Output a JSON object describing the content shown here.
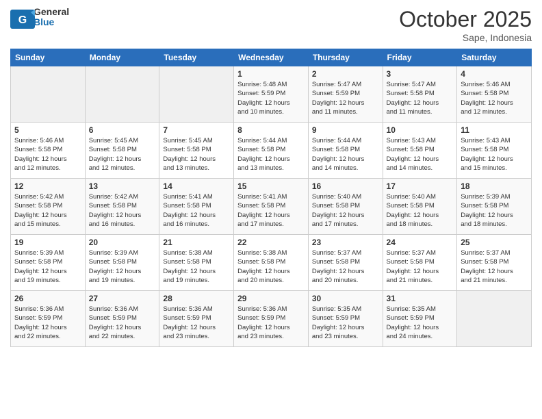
{
  "header": {
    "logo_general": "General",
    "logo_blue": "Blue",
    "title": "October 2025",
    "location": "Sape, Indonesia"
  },
  "days_of_week": [
    "Sunday",
    "Monday",
    "Tuesday",
    "Wednesday",
    "Thursday",
    "Friday",
    "Saturday"
  ],
  "weeks": [
    [
      {
        "day": "",
        "info": ""
      },
      {
        "day": "",
        "info": ""
      },
      {
        "day": "",
        "info": ""
      },
      {
        "day": "1",
        "info": "Sunrise: 5:48 AM\nSunset: 5:59 PM\nDaylight: 12 hours\nand 10 minutes."
      },
      {
        "day": "2",
        "info": "Sunrise: 5:47 AM\nSunset: 5:59 PM\nDaylight: 12 hours\nand 11 minutes."
      },
      {
        "day": "3",
        "info": "Sunrise: 5:47 AM\nSunset: 5:58 PM\nDaylight: 12 hours\nand 11 minutes."
      },
      {
        "day": "4",
        "info": "Sunrise: 5:46 AM\nSunset: 5:58 PM\nDaylight: 12 hours\nand 12 minutes."
      }
    ],
    [
      {
        "day": "5",
        "info": "Sunrise: 5:46 AM\nSunset: 5:58 PM\nDaylight: 12 hours\nand 12 minutes."
      },
      {
        "day": "6",
        "info": "Sunrise: 5:45 AM\nSunset: 5:58 PM\nDaylight: 12 hours\nand 12 minutes."
      },
      {
        "day": "7",
        "info": "Sunrise: 5:45 AM\nSunset: 5:58 PM\nDaylight: 12 hours\nand 13 minutes."
      },
      {
        "day": "8",
        "info": "Sunrise: 5:44 AM\nSunset: 5:58 PM\nDaylight: 12 hours\nand 13 minutes."
      },
      {
        "day": "9",
        "info": "Sunrise: 5:44 AM\nSunset: 5:58 PM\nDaylight: 12 hours\nand 14 minutes."
      },
      {
        "day": "10",
        "info": "Sunrise: 5:43 AM\nSunset: 5:58 PM\nDaylight: 12 hours\nand 14 minutes."
      },
      {
        "day": "11",
        "info": "Sunrise: 5:43 AM\nSunset: 5:58 PM\nDaylight: 12 hours\nand 15 minutes."
      }
    ],
    [
      {
        "day": "12",
        "info": "Sunrise: 5:42 AM\nSunset: 5:58 PM\nDaylight: 12 hours\nand 15 minutes."
      },
      {
        "day": "13",
        "info": "Sunrise: 5:42 AM\nSunset: 5:58 PM\nDaylight: 12 hours\nand 16 minutes."
      },
      {
        "day": "14",
        "info": "Sunrise: 5:41 AM\nSunset: 5:58 PM\nDaylight: 12 hours\nand 16 minutes."
      },
      {
        "day": "15",
        "info": "Sunrise: 5:41 AM\nSunset: 5:58 PM\nDaylight: 12 hours\nand 17 minutes."
      },
      {
        "day": "16",
        "info": "Sunrise: 5:40 AM\nSunset: 5:58 PM\nDaylight: 12 hours\nand 17 minutes."
      },
      {
        "day": "17",
        "info": "Sunrise: 5:40 AM\nSunset: 5:58 PM\nDaylight: 12 hours\nand 18 minutes."
      },
      {
        "day": "18",
        "info": "Sunrise: 5:39 AM\nSunset: 5:58 PM\nDaylight: 12 hours\nand 18 minutes."
      }
    ],
    [
      {
        "day": "19",
        "info": "Sunrise: 5:39 AM\nSunset: 5:58 PM\nDaylight: 12 hours\nand 19 minutes."
      },
      {
        "day": "20",
        "info": "Sunrise: 5:39 AM\nSunset: 5:58 PM\nDaylight: 12 hours\nand 19 minutes."
      },
      {
        "day": "21",
        "info": "Sunrise: 5:38 AM\nSunset: 5:58 PM\nDaylight: 12 hours\nand 19 minutes."
      },
      {
        "day": "22",
        "info": "Sunrise: 5:38 AM\nSunset: 5:58 PM\nDaylight: 12 hours\nand 20 minutes."
      },
      {
        "day": "23",
        "info": "Sunrise: 5:37 AM\nSunset: 5:58 PM\nDaylight: 12 hours\nand 20 minutes."
      },
      {
        "day": "24",
        "info": "Sunrise: 5:37 AM\nSunset: 5:58 PM\nDaylight: 12 hours\nand 21 minutes."
      },
      {
        "day": "25",
        "info": "Sunrise: 5:37 AM\nSunset: 5:58 PM\nDaylight: 12 hours\nand 21 minutes."
      }
    ],
    [
      {
        "day": "26",
        "info": "Sunrise: 5:36 AM\nSunset: 5:59 PM\nDaylight: 12 hours\nand 22 minutes."
      },
      {
        "day": "27",
        "info": "Sunrise: 5:36 AM\nSunset: 5:59 PM\nDaylight: 12 hours\nand 22 minutes."
      },
      {
        "day": "28",
        "info": "Sunrise: 5:36 AM\nSunset: 5:59 PM\nDaylight: 12 hours\nand 23 minutes."
      },
      {
        "day": "29",
        "info": "Sunrise: 5:36 AM\nSunset: 5:59 PM\nDaylight: 12 hours\nand 23 minutes."
      },
      {
        "day": "30",
        "info": "Sunrise: 5:35 AM\nSunset: 5:59 PM\nDaylight: 12 hours\nand 23 minutes."
      },
      {
        "day": "31",
        "info": "Sunrise: 5:35 AM\nSunset: 5:59 PM\nDaylight: 12 hours\nand 24 minutes."
      },
      {
        "day": "",
        "info": ""
      }
    ]
  ]
}
